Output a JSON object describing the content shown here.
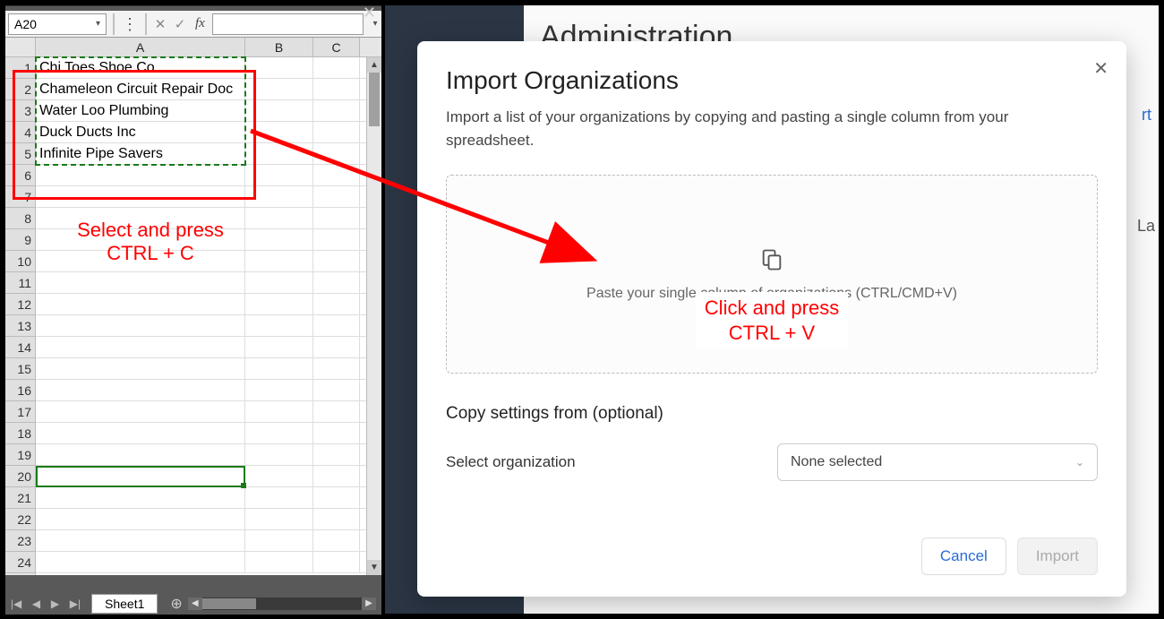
{
  "excel": {
    "close_glyph": "✕",
    "nameBox": "A20",
    "fx_label": "fx",
    "columns": [
      "A",
      "B",
      "C"
    ],
    "rowCount": 24,
    "data": [
      "Chi Toes Shoe Co.",
      "Chameleon Circuit Repair Doc",
      "Water Loo Plumbing",
      "Duck Ducts Inc",
      "Infinite Pipe Savers"
    ],
    "sheetTab": "Sheet1",
    "annotation_copy_l1": "Select and press",
    "annotation_copy_l2": "CTRL + C"
  },
  "background": {
    "admin_title": "Administration",
    "stray_rt": "rt",
    "stray_la": "La"
  },
  "modal": {
    "title": "Import Organizations",
    "description": "Import a list of your organizations by copying and pasting a single column from your spreadsheet.",
    "paste_placeholder": "Paste your single column of organizations (CTRL/CMD+V)",
    "annotation_paste_l1": "Click and press",
    "annotation_paste_l2": "CTRL + V",
    "copy_settings_title": "Copy settings from (optional)",
    "select_label": "Select organization",
    "select_value": "None selected",
    "cancel": "Cancel",
    "import": "Import",
    "close_glyph": "✕"
  },
  "icons": {
    "paste": "📋",
    "caret": "▾",
    "add": "⊕",
    "check": "✓",
    "x": "✕",
    "up": "▲",
    "down": "▼",
    "left": "◀",
    "right": "▶"
  }
}
